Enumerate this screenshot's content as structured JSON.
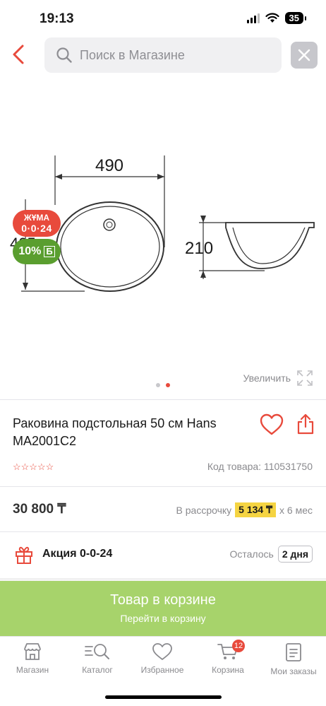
{
  "status_bar": {
    "time": "19:13",
    "battery": "35"
  },
  "search": {
    "placeholder": "Поиск в Магазине"
  },
  "gallery": {
    "dimension_width": "490",
    "dimension_height": "210",
    "dimension_partial": "405",
    "badge_line1": "ЖҰМА",
    "badge_line2": "0·0·24",
    "discount": "10%",
    "discount_currency": "Б",
    "zoom_label": "Увеличить",
    "slide_count": 2,
    "active_slide": 2
  },
  "product": {
    "title": "Раковина подстольная 50 см Hans MA2001C2",
    "rating": "☆☆☆☆☆",
    "code": "Код товара: 110531750"
  },
  "price": {
    "value": "30 800 ₸",
    "installment_prefix": "В рассрочку",
    "installment_amount": "5 134 ₸",
    "installment_suffix": "х 6 мес"
  },
  "promo": {
    "label": "Акция 0-0-24",
    "remaining_prefix": "Осталось",
    "remaining_days": "2 дня"
  },
  "cart_button": {
    "line1": "Товар в корзине",
    "line2": "Перейти в корзину"
  },
  "tabbar": {
    "shop": "Магазин",
    "catalog": "Каталог",
    "favorites": "Избранное",
    "cart": "Корзина",
    "cart_count": "12",
    "orders": "Мои заказы"
  },
  "colors": {
    "accent": "#e84a3c",
    "cta": "#a7d36b",
    "discount": "#5a9e2f",
    "installment_highlight": "#f5d442"
  }
}
